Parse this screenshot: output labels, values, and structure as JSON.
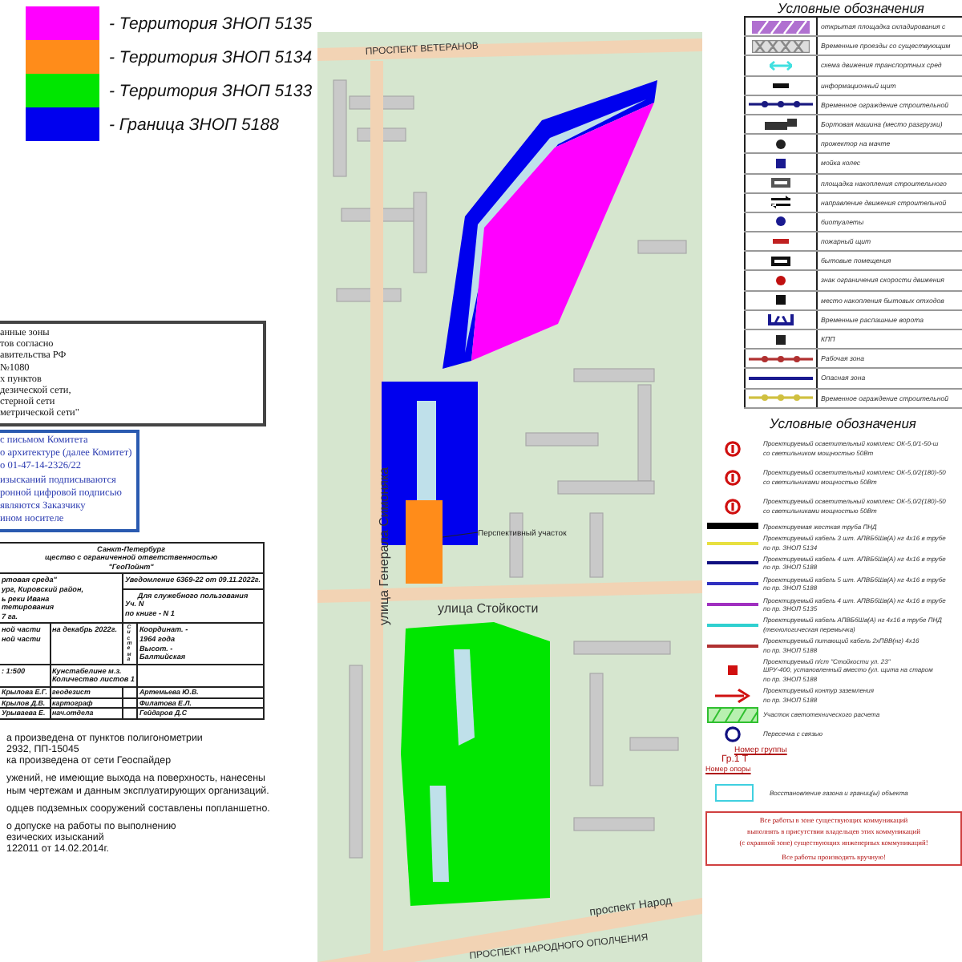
{
  "zones_legend": [
    {
      "label": "- Территория ЗНОП 5135",
      "color": "#ff00ff"
    },
    {
      "label": "- Территория ЗНОП 5134",
      "color": "#ff8c1a"
    },
    {
      "label": "- Территория ЗНОП 5133",
      "color": "#00e600"
    },
    {
      "label": "- Граница ЗНОП 5188",
      "color": "#0000ee"
    }
  ],
  "notes_box": {
    "lines": [
      "анные зоны",
      "тов согласно",
      "авительства РФ",
      "№1080",
      "х пунктов",
      "дезической сети,",
      "стерной сети",
      "метрической сети\""
    ]
  },
  "committee_box": {
    "lines": [
      "с письмом Комитета",
      "о архитектуре (далее Комитет)",
      "о 01-47-14-2326/22",
      "изысканий подписываются",
      "ронной цифровой подписью",
      "являются Заказчику",
      "ином носителе"
    ]
  },
  "title_block": {
    "header": [
      "Санкт-Петербург",
      "щество с ограниченной ответственностью",
      "\"ГеоПойнт\""
    ],
    "object": [
      "ртовая среда\"",
      "ург, Кировский район,",
      "ь реки Ивана",
      "тетирования",
      "7 га."
    ],
    "notice": "Уведомление 6369-22 от 09.11.2022г.",
    "usage": [
      "Для служебного пользования",
      "Уч. N",
      "по книге - N 1"
    ],
    "parts": [
      "ной части",
      "ной части"
    ],
    "date": "на декабрь 2022г.",
    "system_label": "Система",
    "coords": [
      "Координат. -",
      "1964 года",
      "Высот. -",
      "Балтийская"
    ],
    "scale": ": 1:500",
    "sheets": [
      "Кунстабелине     м.з.",
      "Количество листов 1"
    ],
    "staff": [
      {
        "name": "Крылова Е.Г.",
        "role": "геодезист",
        "checker": "Артемьева Ю.В."
      },
      {
        "name": "Крылов Д.В.",
        "role": "картограф",
        "checker": "Филатова Е.Л."
      },
      {
        "name": "Урываева Е.",
        "role": "нач.отдела",
        "checker": "Гейдаров Д.С"
      }
    ]
  },
  "survey_notes": [
    "а произведена от пунктов полигонометрии",
    "2932, ПП-15045",
    "ка произведена от сети Геоспайдер",
    "ужений, не имеющие выхода на поверхность, нанесены",
    "ным чертежам и данным эксплуатирующих организаций.",
    "одцев подземных сооружений составлены попланшетно.",
    "о допуске на работы по выполнению",
    "езических изысканий",
    "122011  от 14.02.2014г."
  ],
  "map": {
    "streets": [
      {
        "kind": "top",
        "name": "ПРОСПЕКТ ВЕТЕРАНОВ"
      },
      {
        "kind": "vertical",
        "name": "улица Генерала Симоняка"
      },
      {
        "kind": "cross",
        "name": "улица Стойкости"
      },
      {
        "kind": "right",
        "name": "проспект Народ"
      },
      {
        "kind": "bottom",
        "name": "ПРОСПЕКТ НАРОДНОГО ОПОЛЧЕНИЯ"
      }
    ],
    "zone_label": "Перспективный участок"
  },
  "legend_table": {
    "title": "Условные обозначения",
    "items": [
      {
        "kind": "hatch",
        "color": "#b070d0",
        "label": "открытая площадка складирования с"
      },
      {
        "kind": "crosshatch",
        "color": "#888888",
        "label": "Временные проезды со существующим"
      },
      {
        "kind": "arrow",
        "color": "#40e0e0",
        "label": "схема движения транспортных сред"
      },
      {
        "kind": "bar",
        "color": "#111111",
        "label": "информационный щит"
      },
      {
        "kind": "fence",
        "color": "#1a1a80",
        "label": "Временное ограждение строительной"
      },
      {
        "kind": "truck",
        "color": "#333333",
        "label": "Бортовая машина (место разгрузки)"
      },
      {
        "kind": "dot",
        "color": "#222222",
        "label": "прожектор на мачте"
      },
      {
        "kind": "square",
        "color": "#1a1a90",
        "label": "мойка колес"
      },
      {
        "kind": "box",
        "color": "#555555",
        "label": "площадка накопления строительного"
      },
      {
        "kind": "twoway",
        "color": "#111111",
        "label": "направление движения строительной"
      },
      {
        "kind": "dot",
        "color": "#1a1a90",
        "label": "биотуалеты"
      },
      {
        "kind": "bar",
        "color": "#c02020",
        "label": "пожарный щит"
      },
      {
        "kind": "box",
        "color": "#111111",
        "label": "бытовые помещения"
      },
      {
        "kind": "dot",
        "color": "#c01010",
        "label": "знак ограничения скорости движения"
      },
      {
        "kind": "square",
        "color": "#111111",
        "label": "место накопления бытовых отходов"
      },
      {
        "kind": "gate",
        "color": "#1a1a90",
        "label": "Временные распашные ворота"
      },
      {
        "kind": "square",
        "color": "#222222",
        "label": "КПП"
      },
      {
        "kind": "fence",
        "color": "#b03030",
        "label": "Рабочая зона"
      },
      {
        "kind": "line",
        "color": "#1a1a90",
        "label": "Опасная зона"
      },
      {
        "kind": "fence",
        "color": "#d0c040",
        "label": "Временное ограждение строительной"
      }
    ]
  },
  "legend_list": {
    "title": "Условные обозначения",
    "items": [
      {
        "kind": "lamp",
        "color": "#d01010",
        "lines": [
          "Проектируемый осветительный комплекс ОК-5,0/1-50-ш",
          "со светильником мощностью 50Вт"
        ]
      },
      {
        "kind": "lamp",
        "color": "#d01010",
        "lines": [
          "Проектируемый осветительный комплекс ОК-5,0/2(180)-50",
          "со светильниками мощностью 50Вт"
        ]
      },
      {
        "kind": "lamp",
        "color": "#d01010",
        "lines": [
          "Проектируемый осветительный комплекс ОК-5,0/2(180)-50",
          "со светильниками мощностью 50Вт"
        ]
      },
      {
        "kind": "pipe",
        "color": "#000000",
        "lines": [
          "Проектируемая жесткая труба ПНД"
        ]
      },
      {
        "kind": "line",
        "color": "#e8e040",
        "lines": [
          "Проектируемый кабель 3 шт. АПВБбШв(А) нг 4х16 в трубе",
          "по пр. ЗНОП 5134"
        ]
      },
      {
        "kind": "line",
        "color": "#101080",
        "lines": [
          "Проектируемый кабель 4 шт. АПВБбШв(А) нг 4х16 в трубе",
          "по пр. ЗНОП 5188"
        ]
      },
      {
        "kind": "line",
        "color": "#3030c0",
        "lines": [
          "Проектируемый кабель 5 шт. АПВБбШв(А) нг 4х16 в трубе",
          "по пр. ЗНОП 5188"
        ]
      },
      {
        "kind": "line",
        "color": "#a030c0",
        "lines": [
          "Проектируемый кабель 4 шт. АПВБбШв(А) нг 4х16 в трубе",
          "по пр. ЗНОП 5135"
        ]
      },
      {
        "kind": "line",
        "color": "#30d0d0",
        "lines": [
          "Проектируемый кабель АПВБбШв(А) нг 4х16 в трубе ПНД",
          "(технологическая перемычка)"
        ]
      },
      {
        "kind": "line",
        "color": "#b03030",
        "lines": [
          "Проектируемый питающий кабель 2хПВВ(нг) 4х16",
          "по пр. ЗНОП 5188"
        ]
      },
      {
        "kind": "square",
        "color": "#d01010",
        "lines": [
          "Проектируемый п/ст \"Стойкости ул. 23\"",
          "ШРУ-400, установленный вместо (ул. щита на старом",
          "по пр. ЗНОП 5188"
        ]
      },
      {
        "kind": "arrow",
        "color": "#d01010",
        "lines": [
          "Проектируемый контур заземления",
          "по пр. ЗНОП 5188"
        ]
      },
      {
        "kind": "hatch",
        "color": "#30c030",
        "lines": [
          "Участок светотехнического расчета"
        ]
      },
      {
        "kind": "circle",
        "color": "#101080",
        "lines": [
          "Пересечка с связью"
        ]
      }
    ],
    "group_labels": [
      "Номер группы",
      "Гр.1 Т",
      "Номер опоры"
    ],
    "restore": {
      "color": "#40d0e0",
      "text": "Восстановление газона и границ(ы) объекта"
    }
  },
  "warning": {
    "lines": [
      "Все работы в зоне существующих коммуникаций",
      "выполнять в присутствии владельцев этих коммуникаций",
      "(с охранной зоне) существующих инженерных коммуникаций!",
      "Все работы производить вручную!"
    ]
  }
}
